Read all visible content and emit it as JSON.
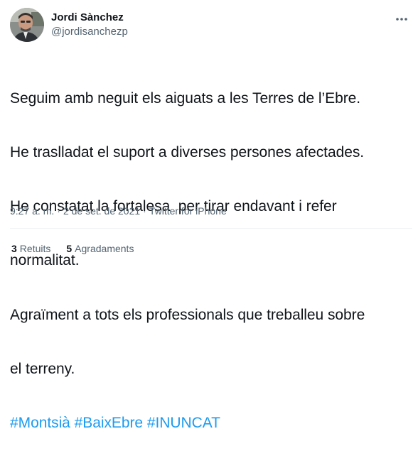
{
  "author": {
    "display_name": "Jordi Sànchez",
    "handle": "@jordisanchezp"
  },
  "tweet": {
    "lines": [
      "Seguim amb neguit els aiguats a les Terres de l’Ebre.",
      "He traslladat el suport a diverses persones afectades.",
      "He constatat la fortalesa  per tirar endavant i refer",
      "normalitat.",
      "Agraïment a tots els professionals que treballeu sobre",
      "el terreny."
    ],
    "hashtags": [
      "#Montsià",
      "#BaixEbre",
      "#INUNCAT"
    ]
  },
  "meta": {
    "time": "9:27 a. m.",
    "separator": "·",
    "date": "2 de set. de 2021",
    "source": "Twitter for iPhone"
  },
  "stats": {
    "retweets_count": "3",
    "retweets_label": "Retuits",
    "likes_count": "5",
    "likes_label": "Agradaments"
  },
  "icons": {
    "more": "more-dots-icon",
    "avatar": "avatar-photo"
  },
  "colors": {
    "link": "#1d9bf0",
    "secondary": "#536471",
    "text": "#0f1419",
    "divider": "#eff3f4"
  }
}
